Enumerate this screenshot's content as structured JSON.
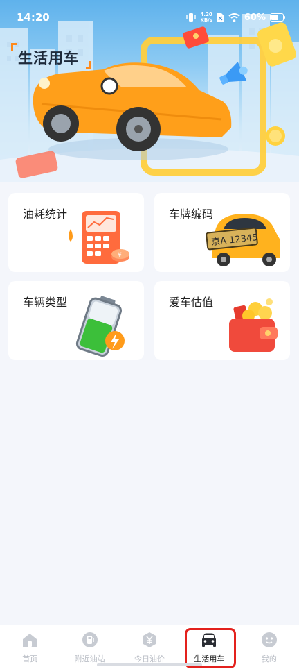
{
  "status_bar": {
    "time": "14:20",
    "net_speed_value": "4.20",
    "net_speed_unit": "KB/s",
    "battery": "60%"
  },
  "hero": {
    "title": "生活用车",
    "plate_text": "京A 12345"
  },
  "cards": [
    {
      "label": "油耗统计",
      "icon": "fuel-calculator-icon"
    },
    {
      "label": "车牌编码",
      "icon": "license-plate-car-icon"
    },
    {
      "label": "车辆类型",
      "icon": "battery-charging-icon"
    },
    {
      "label": "爱车估值",
      "icon": "wallet-coins-icon"
    }
  ],
  "tabbar": {
    "items": [
      {
        "label": "首页",
        "icon": "home-icon",
        "active": false
      },
      {
        "label": "附近油站",
        "icon": "fuel-pump-icon",
        "active": false
      },
      {
        "label": "今日油价",
        "icon": "yuan-price-icon",
        "active": false
      },
      {
        "label": "生活用车",
        "icon": "car-icon",
        "active": true
      },
      {
        "label": "我的",
        "icon": "profile-icon",
        "active": false
      }
    ]
  },
  "colors": {
    "accent": "#ff8a1c",
    "highlight_outline": "#e3211d",
    "inactive_tab": "#b8bcc4",
    "active_tab": "#222222"
  }
}
